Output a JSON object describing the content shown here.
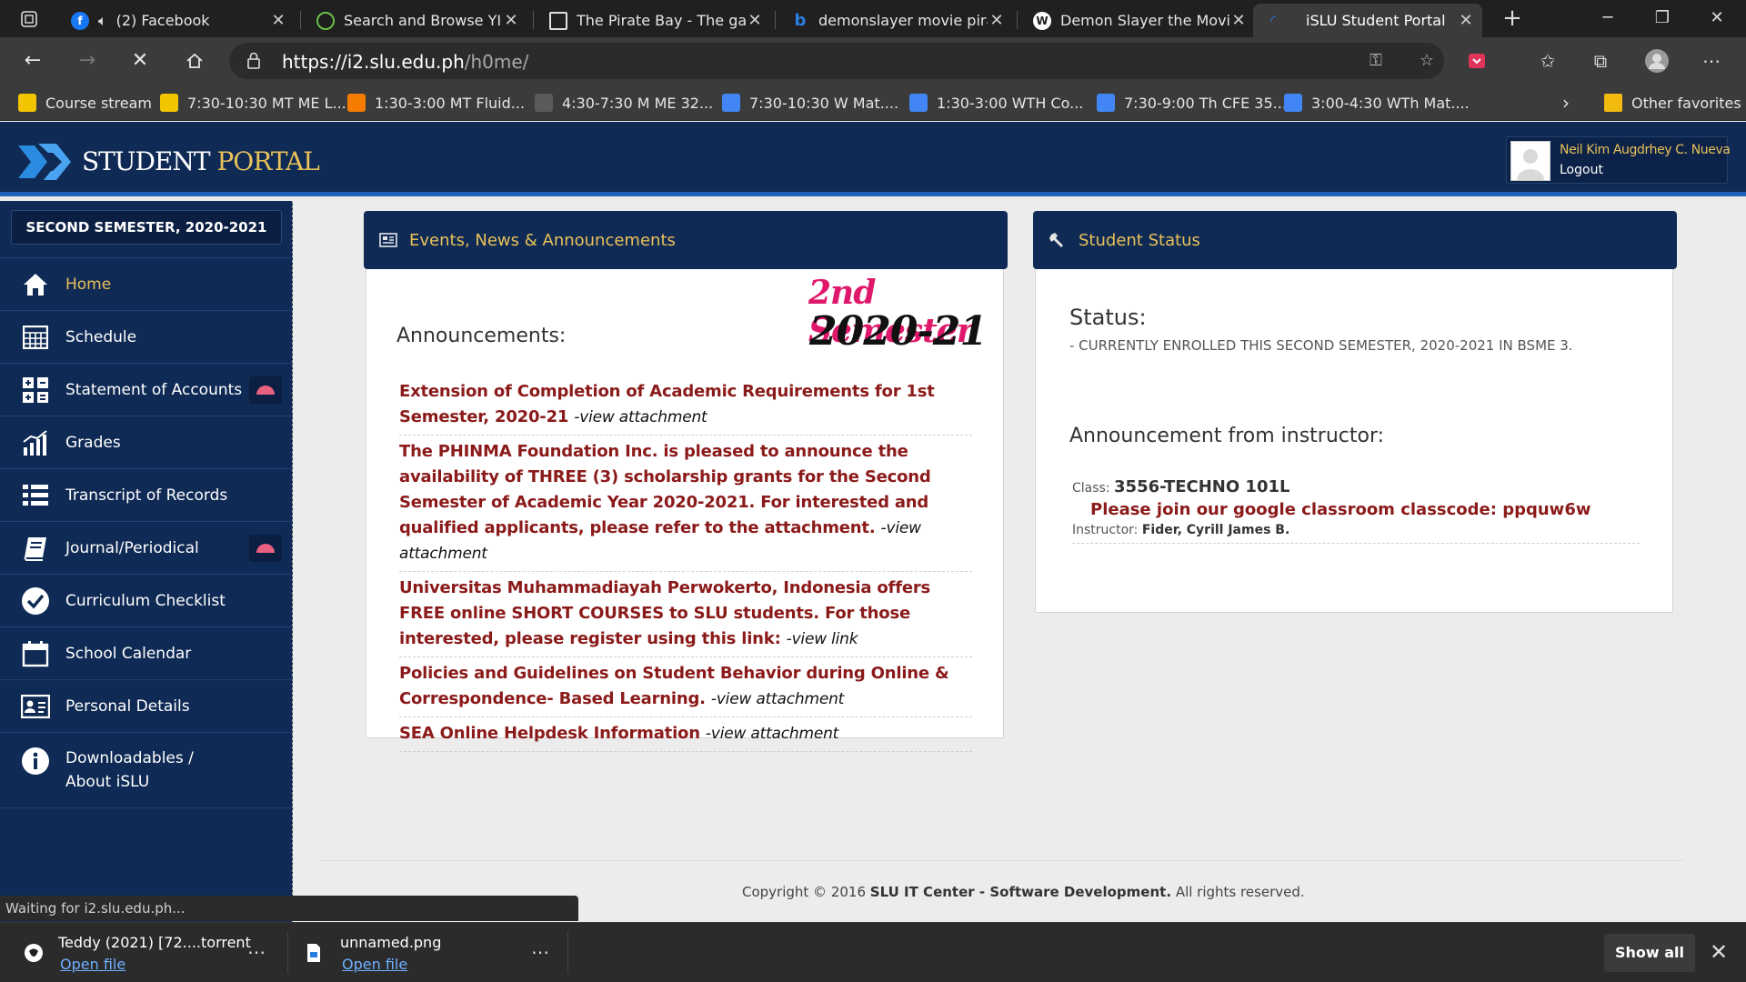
{
  "browser": {
    "tabs": [
      {
        "title": "(2) Facebook",
        "icon": "facebook-icon",
        "color": "#1877f2"
      },
      {
        "title": "Search and Browse YIFY",
        "icon": "yify-icon",
        "color": "#6ac045"
      },
      {
        "title": "The Pirate Bay - The gala",
        "icon": "pirate-bay-icon",
        "color": "#ffffff"
      },
      {
        "title": "demonslayer movie pirat",
        "icon": "bing-icon",
        "color": "#2a7de1"
      },
      {
        "title": "Demon Slayer the Movie",
        "icon": "wordpress-icon",
        "color": "#ffffff"
      },
      {
        "title": "iSLU Student Portal",
        "icon": "slu-icon",
        "color": "#2a7de1"
      }
    ],
    "url_main": "https://i2.slu.edu.ph",
    "url_path": "/h0me/",
    "favorites": [
      {
        "label": "Course stream"
      },
      {
        "label": "7:30-10:30 MT ME L..."
      },
      {
        "label": "1:30-3:00 MT Fluid..."
      },
      {
        "label": "4:30-7:30 M ME 32..."
      },
      {
        "label": "7:30-10:30 W Mat...."
      },
      {
        "label": "1:30-3:00 WTH Co..."
      },
      {
        "label": "7:30-9:00 Th CFE 35..."
      },
      {
        "label": "3:00-4:30 WTh Mat...."
      }
    ],
    "other_favorites": "Other favorites",
    "status_text": "Waiting for i2.slu.edu.ph...",
    "downloads": [
      {
        "name": "Teddy (2021) [72....torrent",
        "action": "Open file"
      },
      {
        "name": "unnamed.png",
        "action": "Open file"
      }
    ],
    "show_all": "Show all"
  },
  "portal": {
    "logo_word1": "STUDENT",
    "logo_word2": "PORTAL",
    "user_name": "Neil Kim Augdrhey C. Nueva",
    "logout": "Logout",
    "semester": "SECOND SEMESTER, 2020-2021",
    "menu": [
      {
        "label": "Home",
        "icon": "home-icon"
      },
      {
        "label": "Schedule",
        "icon": "calendar-grid-icon"
      },
      {
        "label": "Statement of Accounts",
        "icon": "calculator-icon"
      },
      {
        "label": "Grades",
        "icon": "bar-chart-icon"
      },
      {
        "label": "Transcript of Records",
        "icon": "list-icon"
      },
      {
        "label": "Journal/Periodical",
        "icon": "book-icon"
      },
      {
        "label": "Curriculum Checklist",
        "icon": "check-circle-icon"
      },
      {
        "label": "School Calendar",
        "icon": "calendar-icon"
      },
      {
        "label": "Personal Details",
        "icon": "id-card-icon"
      },
      {
        "label": "Downloadables /",
        "label2": "About iSLU",
        "icon": "info-icon"
      }
    ],
    "events_title": "Events, News & Announcements",
    "sem_badge_line1": "2nd Semester",
    "sem_badge_line2": "2020-21",
    "announcements_title": "Announcements:",
    "announcements": [
      {
        "text": "Extension of Completion of Academic Requirements for 1st Semester, 2020-21",
        "link": "-view attachment"
      },
      {
        "text": "The PHINMA Foundation Inc. is pleased to announce the availability of THREE (3) scholarship grants for the Second Semester of Academic Year 2020-2021. For interested and qualified applicants, please refer to the attachment.",
        "link": "-view attachment"
      },
      {
        "text": "Universitas Muhammadiayah Perwokerto, Indonesia offers FREE online SHORT COURSES to SLU students. For those interested, please register using this link:",
        "link": "-view link"
      },
      {
        "text": "Policies and Guidelines on Student Behavior during Online & Correspondence- Based Learning.",
        "link": "-view attachment"
      },
      {
        "text": "SEA Online Helpdesk Information",
        "link": "-view attachment"
      }
    ],
    "status_title": "Student Status",
    "status_label": "Status:",
    "status_value": "- CURRENTLY ENROLLED THIS SECOND SEMESTER, 2020-2021 IN BSME 3.",
    "instructor_title": "Announcement from instructor:",
    "class_label": "Class:",
    "class_value": "3556-TECHNO 101L",
    "instructor_message": "Please join our google classroom classcode: ppquw6w",
    "instructor_label": "Instructor:",
    "instructor_name": "Fider, Cyrill James B.",
    "copyright_pre": "Copyright © 2016",
    "copyright_org": "SLU IT Center - Software Development.",
    "copyright_post": "All rights reserved."
  },
  "colors": {
    "navy": "#0f2a55",
    "gold": "#e9c158",
    "maroon": "#8b1a1a",
    "magenta": "#e0186b"
  }
}
